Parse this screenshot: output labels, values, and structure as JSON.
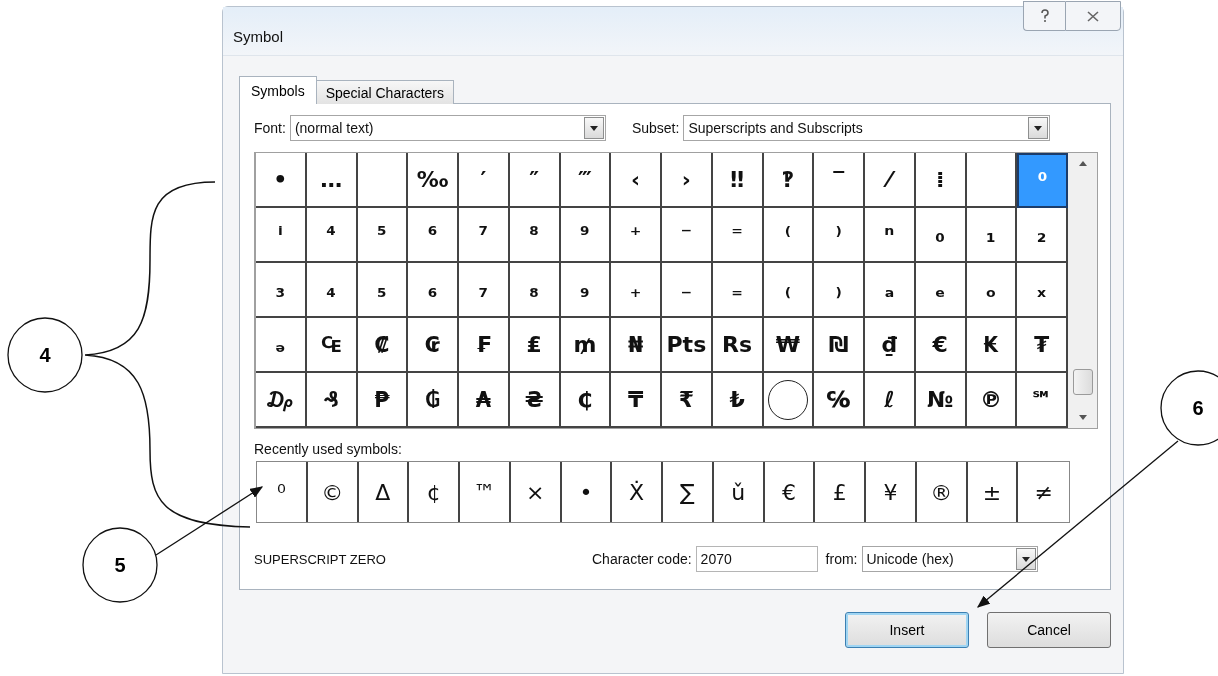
{
  "window": {
    "title": "Symbol"
  },
  "tabs": [
    {
      "label": "Symbols",
      "selected": true
    },
    {
      "label": "Special Characters",
      "selected": false
    }
  ],
  "font": {
    "label": "Font:",
    "value": "(normal text)"
  },
  "subset": {
    "label": "Subset:",
    "value": "Superscripts and Subscripts"
  },
  "symbol_grid": [
    {
      "glyph": "•",
      "selected": false
    },
    {
      "glyph": "…",
      "selected": false
    },
    {
      "kind": "blank",
      "selected": false
    },
    {
      "glyph": "‰",
      "selected": false
    },
    {
      "glyph": "′",
      "selected": false
    },
    {
      "glyph": "″",
      "selected": false
    },
    {
      "glyph": "‴",
      "selected": false
    },
    {
      "glyph": "‹",
      "selected": false
    },
    {
      "glyph": "›",
      "selected": false
    },
    {
      "glyph": "‼",
      "selected": false
    },
    {
      "glyph": "‽",
      "selected": false
    },
    {
      "glyph": "‾",
      "selected": false
    },
    {
      "glyph": "⁄",
      "selected": false
    },
    {
      "glyph": "⁞",
      "selected": false
    },
    {
      "kind": "blank",
      "selected": false
    },
    {
      "glyph": "⁰",
      "selected": true
    },
    {
      "glyph": "ⁱ",
      "selected": false
    },
    {
      "glyph": "⁴",
      "selected": false
    },
    {
      "glyph": "⁵",
      "selected": false
    },
    {
      "glyph": "⁶",
      "selected": false
    },
    {
      "glyph": "⁷",
      "selected": false
    },
    {
      "glyph": "⁸",
      "selected": false
    },
    {
      "glyph": "⁹",
      "selected": false
    },
    {
      "glyph": "⁺",
      "selected": false
    },
    {
      "glyph": "⁻",
      "selected": false
    },
    {
      "glyph": "⁼",
      "selected": false
    },
    {
      "glyph": "⁽",
      "selected": false
    },
    {
      "glyph": "⁾",
      "selected": false
    },
    {
      "glyph": "ⁿ",
      "selected": false
    },
    {
      "glyph": "₀",
      "selected": false
    },
    {
      "glyph": "₁",
      "selected": false
    },
    {
      "glyph": "₂",
      "selected": false
    },
    {
      "glyph": "₃",
      "selected": false
    },
    {
      "glyph": "₄",
      "selected": false
    },
    {
      "glyph": "₅",
      "selected": false
    },
    {
      "glyph": "₆",
      "selected": false
    },
    {
      "glyph": "₇",
      "selected": false
    },
    {
      "glyph": "₈",
      "selected": false
    },
    {
      "glyph": "₉",
      "selected": false
    },
    {
      "glyph": "₊",
      "selected": false
    },
    {
      "glyph": "₋",
      "selected": false
    },
    {
      "glyph": "₌",
      "selected": false
    },
    {
      "glyph": "₍",
      "selected": false
    },
    {
      "glyph": "₎",
      "selected": false
    },
    {
      "glyph": "ₐ",
      "selected": false
    },
    {
      "glyph": "ₑ",
      "selected": false
    },
    {
      "glyph": "ₒ",
      "selected": false
    },
    {
      "glyph": "ₓ",
      "selected": false
    },
    {
      "glyph": "ₔ",
      "selected": false
    },
    {
      "glyph": "₠",
      "selected": false
    },
    {
      "glyph": "₡",
      "selected": false
    },
    {
      "glyph": "₢",
      "selected": false
    },
    {
      "glyph": "₣",
      "selected": false
    },
    {
      "glyph": "₤",
      "selected": false
    },
    {
      "glyph": "₥",
      "selected": false
    },
    {
      "glyph": "₦",
      "selected": false
    },
    {
      "glyph": "Pts",
      "selected": false
    },
    {
      "glyph": "Rs",
      "selected": false
    },
    {
      "glyph": "₩",
      "selected": false
    },
    {
      "glyph": "₪",
      "selected": false
    },
    {
      "glyph": "₫",
      "selected": false
    },
    {
      "glyph": "€",
      "selected": false
    },
    {
      "glyph": "₭",
      "selected": false
    },
    {
      "glyph": "₮",
      "selected": false
    },
    {
      "glyph": "₯",
      "selected": false
    },
    {
      "glyph": "₰",
      "selected": false
    },
    {
      "glyph": "₱",
      "selected": false
    },
    {
      "glyph": "₲",
      "selected": false
    },
    {
      "glyph": "₳",
      "selected": false
    },
    {
      "glyph": "₴",
      "selected": false
    },
    {
      "glyph": "₵",
      "selected": false
    },
    {
      "glyph": "₸",
      "selected": false
    },
    {
      "glyph": "₹",
      "selected": false
    },
    {
      "glyph": "₺",
      "selected": false
    },
    {
      "kind": "circle",
      "selected": false
    },
    {
      "glyph": "℅",
      "selected": false
    },
    {
      "glyph": "ℓ",
      "selected": false
    },
    {
      "glyph": "№",
      "selected": false
    },
    {
      "glyph": "℗",
      "selected": false
    },
    {
      "glyph": "℠",
      "selected": false
    }
  ],
  "recent_label": "Recently used symbols:",
  "recent_symbols": [
    "⁰",
    "©",
    "Δ",
    "¢",
    "™",
    "×",
    "•",
    "Ẋ",
    "∑",
    "ǔ",
    "€",
    "£",
    "¥",
    "®",
    "±",
    "≠"
  ],
  "character_name": "SUPERSCRIPT ZERO",
  "character_code": {
    "label": "Character code:",
    "value": "2070"
  },
  "from": {
    "label": "from:",
    "value": "Unicode (hex)"
  },
  "buttons": [
    {
      "label": "Insert",
      "kind": "default"
    },
    {
      "label": "Cancel",
      "kind": "normal"
    }
  ],
  "callouts": [
    {
      "label": "4"
    },
    {
      "label": "5"
    },
    {
      "label": "6"
    }
  ]
}
